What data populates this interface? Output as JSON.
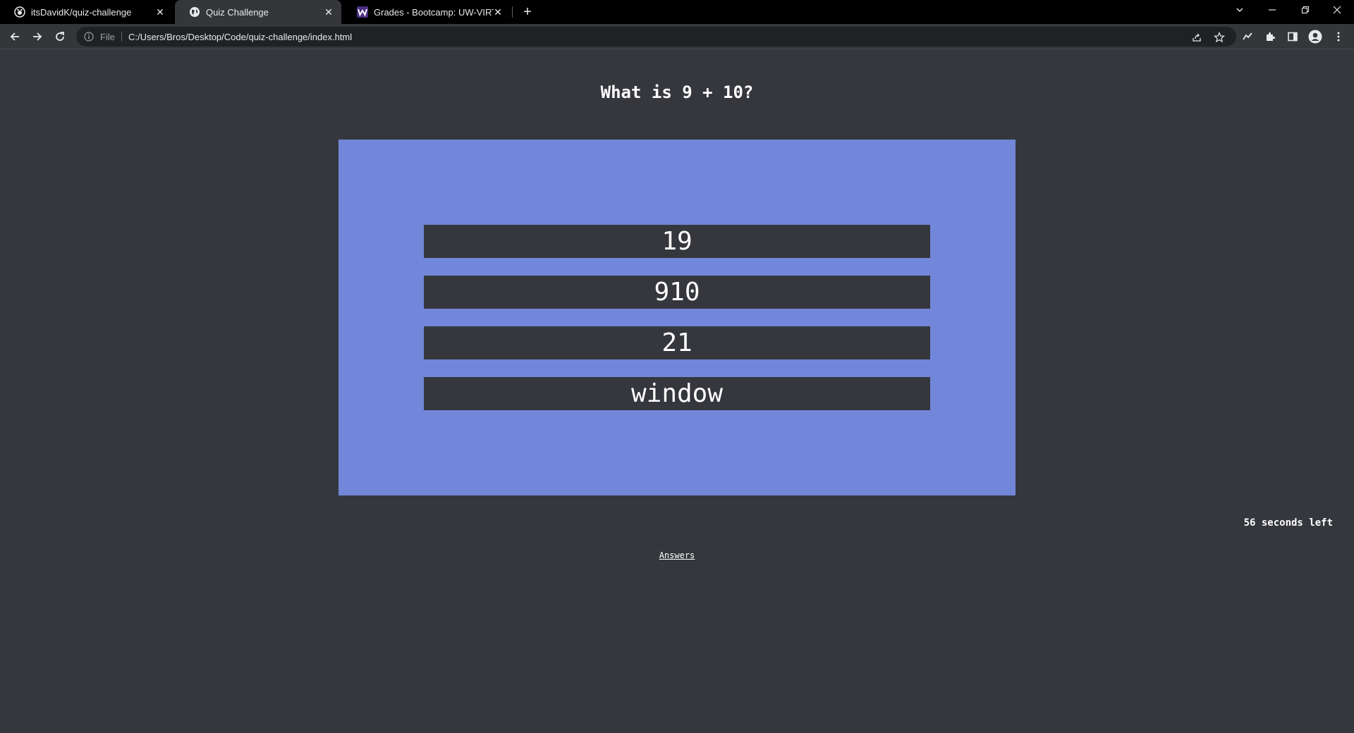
{
  "browser": {
    "tabs": [
      {
        "label": "itsDavidK/quiz-challenge",
        "icon": "github-icon",
        "active": false
      },
      {
        "label": "Quiz Challenge",
        "icon": "globe-icon",
        "active": true
      },
      {
        "label": "Grades - Bootcamp: UW-VIRT-FS",
        "icon": "w-logo-icon",
        "active": false
      }
    ],
    "address": {
      "scheme_label": "File",
      "url": "C:/Users/Bros/Desktop/Code/quiz-challenge/index.html"
    }
  },
  "quiz": {
    "question": "What is 9 + 10?",
    "choices": [
      "19",
      "910",
      "21",
      "window"
    ],
    "timer_text": "56 seconds left",
    "answers_link": "Answers"
  },
  "colors": {
    "page_background": "#35373d",
    "answer_box": "#7287d9",
    "choice_background": "#35373d",
    "text": "#ffffff"
  }
}
